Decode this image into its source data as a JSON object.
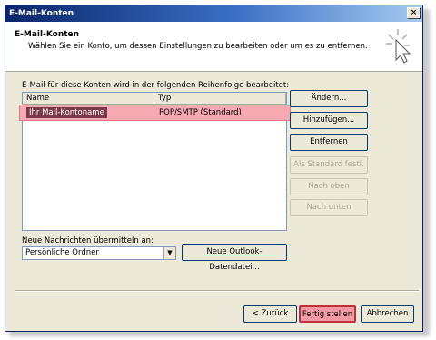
{
  "window": {
    "title": "E-Mail-Konten",
    "close_label": "×"
  },
  "header": {
    "title": "E-Mail-Konten",
    "subtitle": "Wählen Sie ein Konto, um dessen Einstellungen zu bearbeiten oder um es zu entfernen."
  },
  "accounts": {
    "label": "E-Mail für diese Konten wird in der folgenden Reihenfolge bearbeitet:",
    "columns": [
      "Name",
      "Typ"
    ],
    "rows": [
      {
        "name": "Ihr Mail-Kontoname",
        "type": "POP/SMTP (Standard)"
      }
    ]
  },
  "side_buttons": {
    "change": "Ändern...",
    "add": "Hinzufügen...",
    "remove": "Entfernen",
    "set_default": "Als Standard festl.",
    "move_up": "Nach oben",
    "move_down": "Nach unten"
  },
  "delivery": {
    "label": "Neue Nachrichten übermitteln an:",
    "selected": "Persönliche Ordner",
    "new_file_button": "Neue Outlook-Datendatei..."
  },
  "footer": {
    "back": "< Zurück",
    "finish": "Fertig stellen",
    "cancel": "Abbrechen"
  },
  "colors": {
    "title_bar": "#0a246a",
    "highlight": "#f6a9b1",
    "dialog_bg": "#ece9d8"
  }
}
